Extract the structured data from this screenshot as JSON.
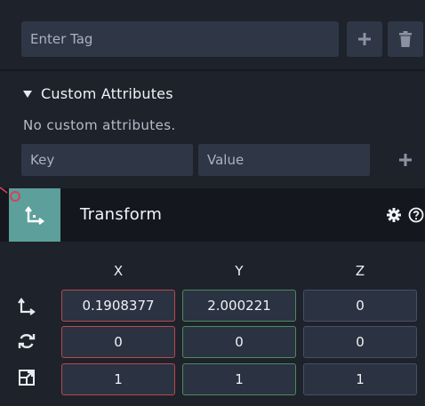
{
  "tags": {
    "input_placeholder": "Enter Tag",
    "add_icon": "plus-icon",
    "delete_icon": "trash-icon"
  },
  "custom_attributes": {
    "title": "Custom Attributes",
    "empty_message": "No custom attributes.",
    "key_placeholder": "Key",
    "value_placeholder": "Value",
    "add_icon": "plus-icon"
  },
  "transform": {
    "title": "Transform",
    "icons": {
      "component": "transform-axis-icon",
      "settings": "gear-icon",
      "help": "help-icon"
    },
    "axes": [
      "X",
      "Y",
      "Z"
    ],
    "rows": [
      {
        "name": "position",
        "icon": "position-icon",
        "values": [
          "0.1908377",
          "2.000221",
          "0"
        ]
      },
      {
        "name": "rotation",
        "icon": "rotate-icon",
        "values": [
          "0",
          "0",
          "0"
        ]
      },
      {
        "name": "scale",
        "icon": "scale-icon",
        "values": [
          "1",
          "1",
          "1"
        ]
      }
    ]
  },
  "colors": {
    "panel_bg": "#1e222b",
    "input_bg": "#2f3746",
    "header_bg": "#14171d",
    "accent_teal": "#5c9f9b",
    "x_axis": "#b94a4a",
    "y_axis": "#4d8a5e",
    "connector_red": "#d0455a"
  }
}
